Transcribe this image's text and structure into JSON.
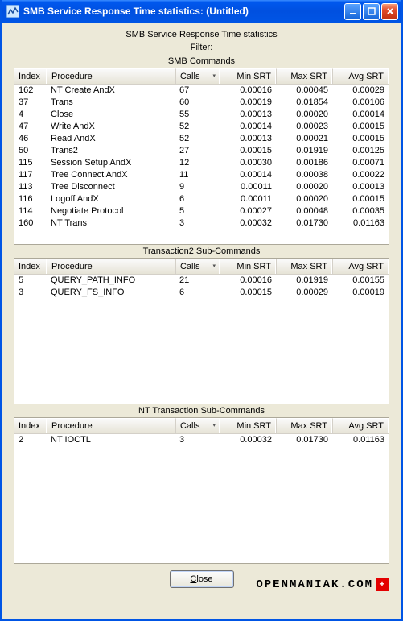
{
  "window": {
    "title": "SMB Service Response Time statistics: (Untitled)"
  },
  "header": {
    "line1": "SMB Service Response Time statistics",
    "line2": "Filter:",
    "section_smb": "SMB Commands",
    "section_trans2": "Transaction2 Sub-Commands",
    "section_nttrans": "NT Transaction Sub-Commands"
  },
  "columns": {
    "index": "Index",
    "procedure": "Procedure",
    "calls": "Calls",
    "min_srt": "Min SRT",
    "max_srt": "Max SRT",
    "avg_srt": "Avg SRT",
    "sort_indicator": "▾"
  },
  "tables": {
    "smb": [
      {
        "index": "162",
        "procedure": "NT Create AndX",
        "calls": "67",
        "min": "0.00016",
        "max": "0.00045",
        "avg": "0.00029"
      },
      {
        "index": "37",
        "procedure": "Trans",
        "calls": "60",
        "min": "0.00019",
        "max": "0.01854",
        "avg": "0.00106"
      },
      {
        "index": "4",
        "procedure": "Close",
        "calls": "55",
        "min": "0.00013",
        "max": "0.00020",
        "avg": "0.00014"
      },
      {
        "index": "47",
        "procedure": "Write AndX",
        "calls": "52",
        "min": "0.00014",
        "max": "0.00023",
        "avg": "0.00015"
      },
      {
        "index": "46",
        "procedure": "Read AndX",
        "calls": "52",
        "min": "0.00013",
        "max": "0.00021",
        "avg": "0.00015"
      },
      {
        "index": "50",
        "procedure": "Trans2",
        "calls": "27",
        "min": "0.00015",
        "max": "0.01919",
        "avg": "0.00125"
      },
      {
        "index": "115",
        "procedure": "Session Setup AndX",
        "calls": "12",
        "min": "0.00030",
        "max": "0.00186",
        "avg": "0.00071"
      },
      {
        "index": "117",
        "procedure": "Tree Connect AndX",
        "calls": "11",
        "min": "0.00014",
        "max": "0.00038",
        "avg": "0.00022"
      },
      {
        "index": "113",
        "procedure": "Tree Disconnect",
        "calls": "9",
        "min": "0.00011",
        "max": "0.00020",
        "avg": "0.00013"
      },
      {
        "index": "116",
        "procedure": "Logoff AndX",
        "calls": "6",
        "min": "0.00011",
        "max": "0.00020",
        "avg": "0.00015"
      },
      {
        "index": "114",
        "procedure": "Negotiate Protocol",
        "calls": "5",
        "min": "0.00027",
        "max": "0.00048",
        "avg": "0.00035"
      },
      {
        "index": "160",
        "procedure": "NT Trans",
        "calls": "3",
        "min": "0.00032",
        "max": "0.01730",
        "avg": "0.01163"
      }
    ],
    "trans2": [
      {
        "index": "5",
        "procedure": "QUERY_PATH_INFO",
        "calls": "21",
        "min": "0.00016",
        "max": "0.01919",
        "avg": "0.00155"
      },
      {
        "index": "3",
        "procedure": "QUERY_FS_INFO",
        "calls": "6",
        "min": "0.00015",
        "max": "0.00029",
        "avg": "0.00019"
      }
    ],
    "nttrans": [
      {
        "index": "2",
        "procedure": "NT IOCTL",
        "calls": "3",
        "min": "0.00032",
        "max": "0.01730",
        "avg": "0.01163"
      }
    ]
  },
  "buttons": {
    "close": "Close"
  },
  "watermark": {
    "text": "OPENMANIAK.COM",
    "flag": "+"
  }
}
